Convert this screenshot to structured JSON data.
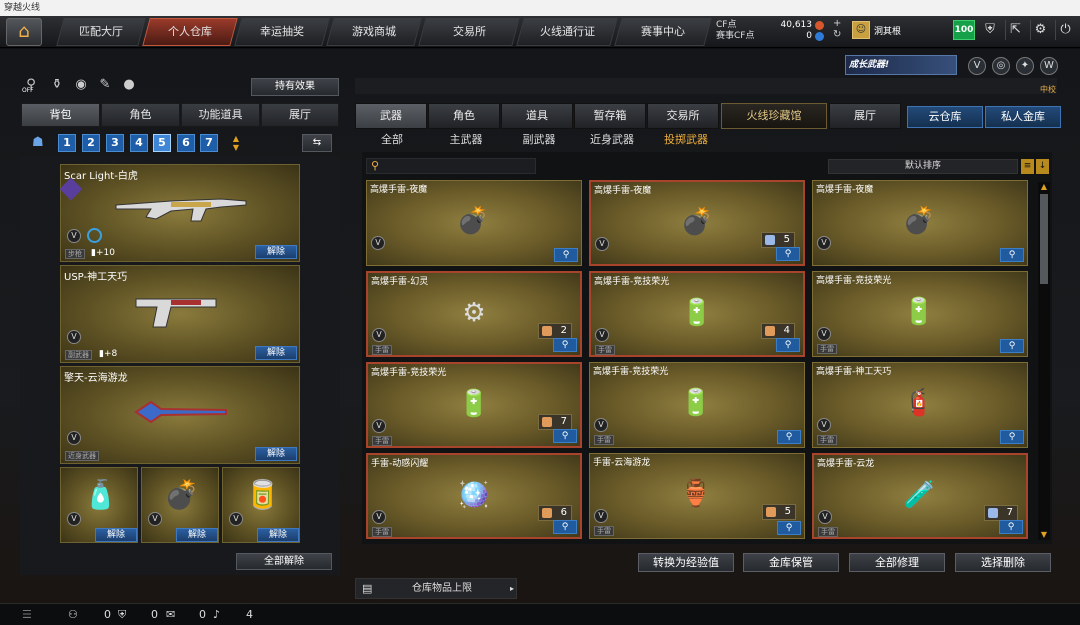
{
  "window_title": "穿越火线",
  "nav": {
    "tabs": [
      "匹配大厅",
      "个人仓库",
      "幸运抽奖",
      "游戏商城",
      "交易所",
      "火线通行证",
      "赛事中心"
    ],
    "active_index": 1
  },
  "account": {
    "cf_label": "CF点",
    "cf_value": "40,613",
    "event_cf_label": "赛事CF点",
    "event_cf_value": "0",
    "username": "洞其根",
    "level": "100"
  },
  "left": {
    "effect_button": "持有效果",
    "off_label": "OFF",
    "tabs": [
      "背包",
      "角色",
      "功能道具",
      "展厅"
    ],
    "active_tab": 0,
    "pages": [
      "1",
      "2",
      "3",
      "4",
      "5",
      "6",
      "7"
    ],
    "current_page": "5",
    "weapons": [
      {
        "name": "Scar Light-白虎",
        "tag": "步枪",
        "plus": "+10",
        "action": "解除"
      },
      {
        "name": "USP-神工天巧",
        "tag": "副武器",
        "plus": "+8",
        "action": "解除"
      },
      {
        "name": "擎天-云海游龙",
        "tag": "近身武器",
        "plus": "",
        "action": "解除"
      }
    ],
    "small_items": [
      {
        "action": "解除"
      },
      {
        "action": "解除"
      },
      {
        "action": "解除"
      }
    ],
    "unequip_all": "全部解除"
  },
  "right": {
    "banner_text": "成长武器!",
    "rank_label": "中校",
    "tabs": [
      "武器",
      "角色",
      "道具",
      "暂存箱",
      "交易所",
      "火线珍藏馆",
      "展厅"
    ],
    "active_tab": 0,
    "extra_tabs": [
      "云仓库",
      "私人金库"
    ],
    "subtabs": [
      "全部",
      "主武器",
      "副武器",
      "近身武器",
      "投掷武器"
    ],
    "active_subtab": 4,
    "search_placeholder": "",
    "sort_label": "默认排序",
    "items": [
      {
        "name": "高爆手雷-夜魔",
        "tag": "",
        "qty": "",
        "red": false,
        "q_style": ""
      },
      {
        "name": "高爆手雷-夜魔",
        "tag": "",
        "qty": "5",
        "red": true,
        "q_style": "blue"
      },
      {
        "name": "高爆手雷-夜魔",
        "tag": "",
        "qty": "",
        "red": false,
        "q_style": ""
      },
      {
        "name": "高爆手雷-幻灵",
        "tag": "手雷",
        "qty": "2",
        "red": true,
        "q_style": "orange"
      },
      {
        "name": "高爆手雷-竞技荣光",
        "tag": "手雷",
        "qty": "4",
        "red": true,
        "q_style": "orange"
      },
      {
        "name": "高爆手雷-竞技荣光",
        "tag": "手雷",
        "qty": "",
        "red": false,
        "q_style": ""
      },
      {
        "name": "高爆手雷-竞技荣光",
        "tag": "手雷",
        "qty": "7",
        "red": true,
        "q_style": "orange"
      },
      {
        "name": "高爆手雷-竞技荣光",
        "tag": "手雷",
        "qty": "",
        "red": false,
        "q_style": ""
      },
      {
        "name": "高爆手雷-神工天巧",
        "tag": "手雷",
        "qty": "",
        "red": false,
        "q_style": ""
      },
      {
        "name": "手雷-动感闪耀",
        "tag": "手雷",
        "qty": "6",
        "red": true,
        "q_style": "orange"
      },
      {
        "name": "手雷-云海游龙",
        "tag": "手雷",
        "qty": "5",
        "red": false,
        "q_style": "orange"
      },
      {
        "name": "高爆手雷-云龙",
        "tag": "手雷",
        "qty": "7",
        "red": true,
        "q_style": "blue"
      }
    ],
    "bottom_buttons": [
      "转换为经验值",
      "金库保管",
      "全部修理",
      "选择删除"
    ],
    "warehouse_limit": "仓库物品上限"
  },
  "statusbar": {
    "friends": "0",
    "clan": "0",
    "chat": "0",
    "volume": "4"
  }
}
